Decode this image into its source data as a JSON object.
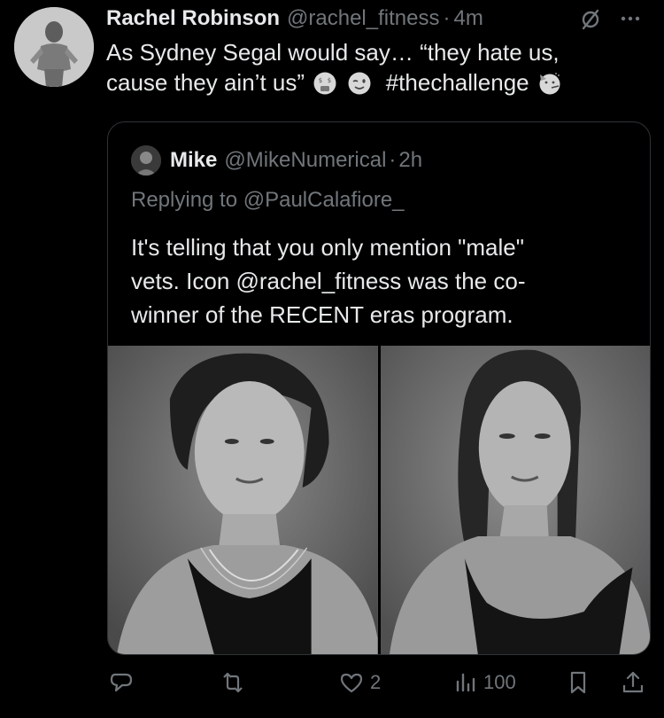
{
  "tweet": {
    "author_name": "Rachel Robinson",
    "handle": "@rachel_fitness",
    "separator": "·",
    "time": "4m",
    "text_line1": "As Sydney Segal would say… “they hate us,",
    "text_line2": "cause they ain’t us”",
    "hashtag": "#thechallenge",
    "emojis": [
      "money-mouth-face-icon",
      "winking-face-icon",
      "partying-face-icon"
    ]
  },
  "quote": {
    "author_name": "Mike",
    "handle": "@MikeNumerical",
    "separator": "·",
    "time": "2h",
    "replying_to": "Replying to @PaulCalafiore_",
    "text_line1": "It's telling that you only mention \"male\"",
    "text_line2": "vets.  Icon @rachel_fitness was the co-",
    "text_line3": "winner of the RECENT eras program.",
    "images": [
      "portrait-short-curly-hair",
      "portrait-long-straight-hair"
    ]
  },
  "actions": {
    "reply_count": "",
    "retweet_count": "",
    "like_count": "2",
    "views_count": "100"
  },
  "colors": {
    "background": "#000000",
    "text_primary": "#e7e9ea",
    "text_secondary": "#71767b",
    "border": "#2f3336"
  }
}
